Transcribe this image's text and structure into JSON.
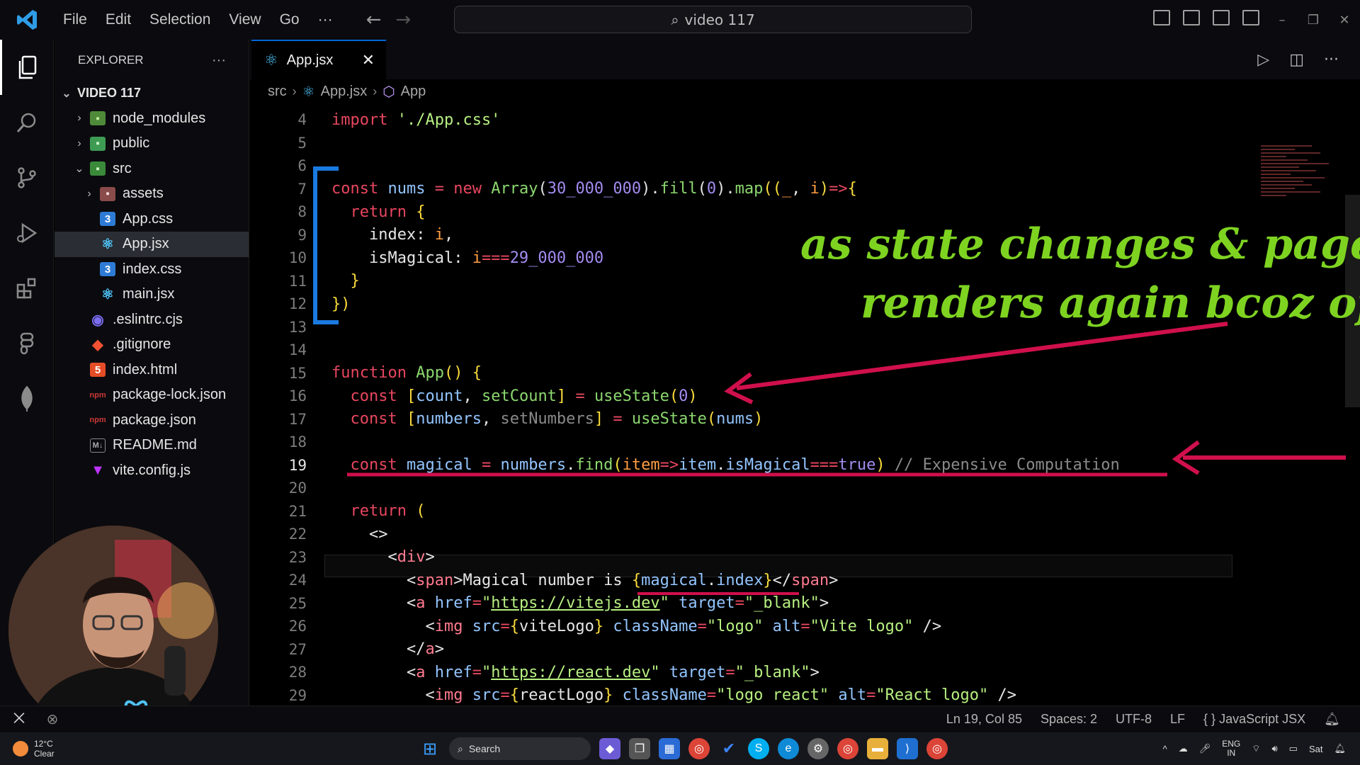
{
  "menu": [
    "File",
    "Edit",
    "Selection",
    "View",
    "Go",
    "···"
  ],
  "search": {
    "text": "video 117"
  },
  "sidebar": {
    "title": "EXPLORER",
    "more": "···",
    "root": "VIDEO 117",
    "items": [
      {
        "label": "node_modules",
        "icon": "folder-icon",
        "type": "folder"
      },
      {
        "label": "public",
        "icon": "folder-icon",
        "type": "folder"
      },
      {
        "label": "src",
        "icon": "folder-open-icon",
        "type": "folder-open"
      },
      {
        "label": "assets",
        "icon": "folder-icon",
        "type": "folder",
        "indent": 1
      },
      {
        "label": "App.css",
        "icon": "css-icon",
        "type": "file",
        "indent": 1
      },
      {
        "label": "App.jsx",
        "icon": "react-icon",
        "type": "file",
        "indent": 1,
        "selected": true
      },
      {
        "label": "index.css",
        "icon": "css-icon",
        "type": "file",
        "indent": 1
      },
      {
        "label": "main.jsx",
        "icon": "react-icon",
        "type": "file",
        "indent": 1
      },
      {
        "label": ".eslintrc.cjs",
        "icon": "eslint-icon",
        "type": "file"
      },
      {
        "label": ".gitignore",
        "icon": "git-icon",
        "type": "file"
      },
      {
        "label": "index.html",
        "icon": "html-icon",
        "type": "file"
      },
      {
        "label": "package-lock.json",
        "icon": "npm-icon",
        "type": "file"
      },
      {
        "label": "package.json",
        "icon": "npm-icon",
        "type": "file"
      },
      {
        "label": "README.md",
        "icon": "markdown-icon",
        "type": "file"
      },
      {
        "label": "vite.config.js",
        "icon": "vite-icon",
        "type": "file"
      }
    ]
  },
  "tab": {
    "label": "App.jsx",
    "close": "✕"
  },
  "breadcrumb": {
    "part1": "src",
    "part2": "App.jsx",
    "part3": "App"
  },
  "code": {
    "current_line": 19,
    "lines": [
      {
        "n": 4,
        "h": "<span class='kw'>import</span> <span class='st'>'./App.css'</span>"
      },
      {
        "n": 5,
        "h": ""
      },
      {
        "n": 6,
        "h": ""
      },
      {
        "n": 7,
        "h": "<span class='kw'>const</span> <span class='at'>nums</span> <span class='kw'>=</span> <span class='kw'>new</span> <span class='fn'>Array</span><span class='wt'>(</span><span class='num'>30_000_000</span><span class='wt'>).</span><span class='fn'>fill</span><span class='wt'>(</span><span class='num'>0</span><span class='wt'>).</span><span class='fn'>map</span><span class='br'>((</span><span class='pa'>_</span><span class='wt'>, </span><span class='pa'>i</span><span class='br'>)</span><span class='kw'>=></span><span class='br'>{</span>"
      },
      {
        "n": 8,
        "h": "  <span class='kw'>return</span> <span class='br'>{</span>"
      },
      {
        "n": 9,
        "h": "    <span class='wt'>index: </span><span class='pa'>i</span><span class='wt'>,</span>"
      },
      {
        "n": 10,
        "h": "    <span class='wt'>isMagical: </span><span class='pa'>i</span><span class='kw'>===</span><span class='num'>29_000_000</span>"
      },
      {
        "n": 11,
        "h": "  <span class='br'>}</span>"
      },
      {
        "n": 12,
        "h": "<span class='br'>})</span>"
      },
      {
        "n": 13,
        "h": ""
      },
      {
        "n": 14,
        "h": ""
      },
      {
        "n": 15,
        "h": "<span class='kw'>function</span> <span class='fn'>App</span><span class='br'>()</span> <span class='br'>{</span>"
      },
      {
        "n": 16,
        "h": "  <span class='kw'>const</span> <span class='br'>[</span><span class='at'>count</span><span class='wt'>, </span><span class='fn'>setCount</span><span class='br'>]</span> <span class='kw'>=</span> <span class='fn'>useState</span><span class='br'>(</span><span class='num'>0</span><span class='br'>)</span>"
      },
      {
        "n": 17,
        "h": "  <span class='kw'>const</span> <span class='br'>[</span><span class='at'>numbers</span><span class='wt'>, </span><span class='cm'>setNumbers</span><span class='br'>]</span> <span class='kw'>=</span> <span class='fn'>useState</span><span class='br'>(</span><span class='at'>nums</span><span class='br'>)</span>"
      },
      {
        "n": 18,
        "h": ""
      },
      {
        "n": 19,
        "h": "  <span class='kw'>const</span> <span class='at'>magical</span> <span class='kw'>=</span> <span class='at'>numbers</span><span class='wt'>.</span><span class='fn'>find</span><span class='br'>(</span><span class='pa'>item</span><span class='kw'>=></span><span class='at'>item</span><span class='wt'>.</span><span class='at'>isMagical</span><span class='kw'>===</span><span class='num'>true</span><span class='br'>)</span> <span class='cm'>// Expensive Computation</span>"
      },
      {
        "n": 20,
        "h": ""
      },
      {
        "n": 21,
        "h": "  <span class='kw'>return</span> <span class='br'>(</span>"
      },
      {
        "n": 22,
        "h": "    <span class='wt'>&lt;&gt;</span>"
      },
      {
        "n": 23,
        "h": "      <span class='wt'>&lt;</span><span class='tg'>div</span><span class='wt'>&gt;</span>"
      },
      {
        "n": 24,
        "h": "        <span class='wt'>&lt;</span><span class='tg'>span</span><span class='wt'>&gt;Magical number is </span><span class='br'>{</span><span class='at'>magical</span><span class='wt'>.</span><span class='at'>index</span><span class='br'>}</span><span class='wt'>&lt;/</span><span class='tg'>span</span><span class='wt'>&gt;</span>"
      },
      {
        "n": 25,
        "h": "        <span class='wt'>&lt;</span><span class='tg'>a</span> <span class='at'>href</span><span class='kw'>=</span><span class='st'>\"<u>https://vitejs.dev</u>\"</span> <span class='at'>target</span><span class='kw'>=</span><span class='st'>\"_blank\"</span><span class='wt'>&gt;</span>"
      },
      {
        "n": 26,
        "h": "          <span class='wt'>&lt;</span><span class='tg'>img</span> <span class='at'>src</span><span class='kw'>=</span><span class='br'>{</span><span class='wt'>viteLogo</span><span class='br'>}</span> <span class='at'>className</span><span class='kw'>=</span><span class='st'>\"logo\"</span> <span class='at'>alt</span><span class='kw'>=</span><span class='st'>\"Vite logo\"</span> <span class='wt'>/&gt;</span>"
      },
      {
        "n": 27,
        "h": "        <span class='wt'>&lt;/</span><span class='tg'>a</span><span class='wt'>&gt;</span>"
      },
      {
        "n": 28,
        "h": "        <span class='wt'>&lt;</span><span class='tg'>a</span> <span class='at'>href</span><span class='kw'>=</span><span class='st'>\"<u>https://react.dev</u>\"</span> <span class='at'>target</span><span class='kw'>=</span><span class='st'>\"_blank\"</span><span class='wt'>&gt;</span>"
      },
      {
        "n": 29,
        "h": "          <span class='wt'>&lt;</span><span class='tg'>img</span> <span class='at'>src</span><span class='kw'>=</span><span class='br'>{</span><span class='wt'>reactLogo</span><span class='br'>}</span> <span class='at'>className</span><span class='kw'>=</span><span class='st'>\"logo react\"</span> <span class='at'>alt</span><span class='kw'>=</span><span class='st'>\"React logo\"</span> <span class='wt'>/&gt;</span>"
      }
    ]
  },
  "annotation": {
    "line1": "as state changes & page",
    "line2": "renders again bcoz of"
  },
  "statusbar": {
    "position": "Ln 19, Col 85",
    "spaces": "Spaces: 2",
    "encoding": "UTF-8",
    "eol": "LF",
    "language": "JavaScript JSX",
    "language_icon": "{ }"
  },
  "taskbar": {
    "temp": "12°C",
    "weather": "Clear",
    "search": "Search",
    "lang1": "ENG",
    "lang2": "IN",
    "day": "Sat"
  },
  "colors": {
    "accent": "#0066d6",
    "annotation_green": "#7ed321",
    "annotation_red": "#d0104c",
    "bracket_blue": "#1a7ae0"
  }
}
